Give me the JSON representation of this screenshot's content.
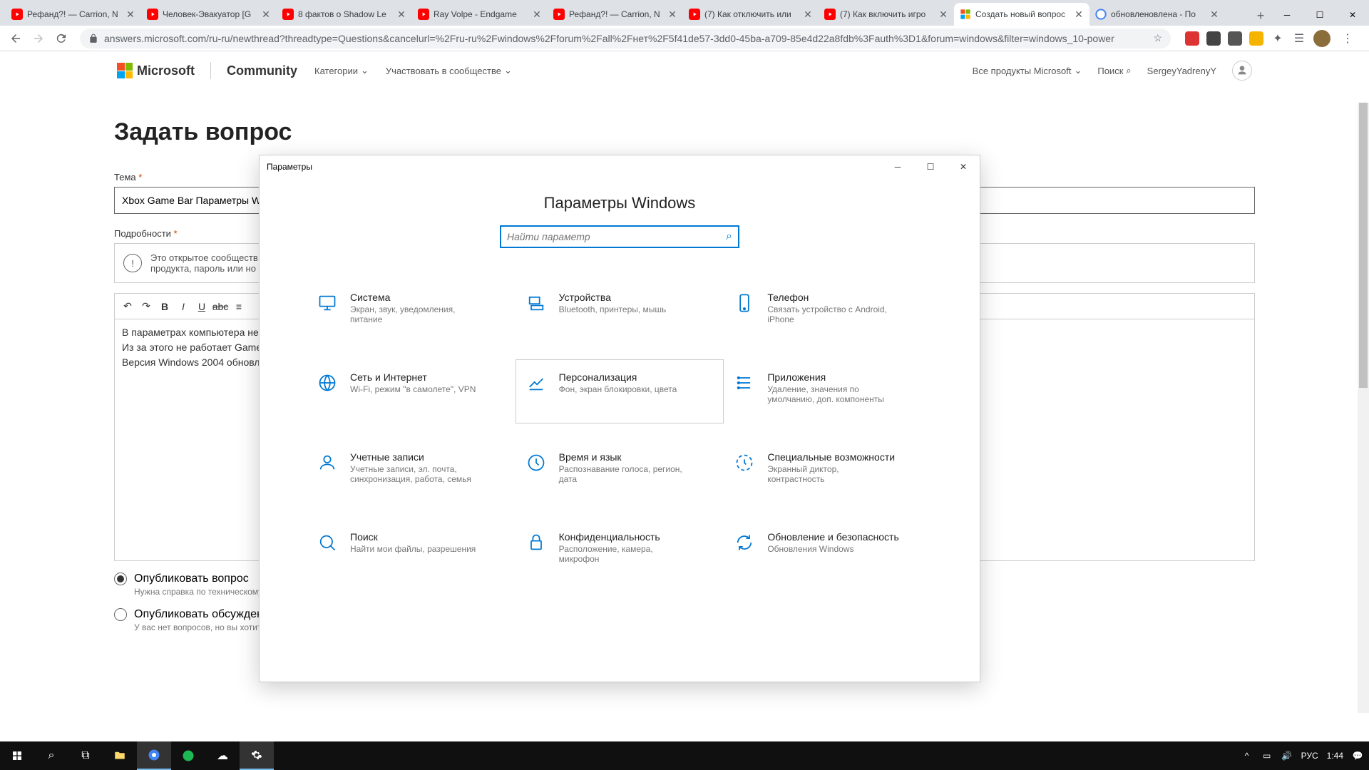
{
  "tabs": [
    {
      "title": "Рефанд?! — Carrion, N",
      "icon": "yt"
    },
    {
      "title": "Человек-Эвакуатор [G",
      "icon": "yt"
    },
    {
      "title": "8 фактов о Shadow Le",
      "icon": "yt"
    },
    {
      "title": "Ray Volpe - Endgame",
      "icon": "yt"
    },
    {
      "title": "Рефанд?! — Carrion, N",
      "icon": "yt"
    },
    {
      "title": "(7) Как отключить или",
      "icon": "yt"
    },
    {
      "title": "(7) Как включить игро",
      "icon": "yt"
    },
    {
      "title": "Создать новый вопрос",
      "icon": "ms",
      "active": true
    },
    {
      "title": "обновленовлена - По",
      "icon": "g"
    }
  ],
  "browser": {
    "url": "answers.microsoft.com/ru-ru/newthread?threadtype=Questions&cancelurl=%2Fru-ru%2Fwindows%2Fforum%2Fall%2Fнет%2F5f41de57-3dd0-45ba-a709-85e4d22a8fdb%3Fauth%3D1&forum=windows&filter=windows_10-power"
  },
  "ms": {
    "brand": "Microsoft",
    "community": "Community",
    "nav1": "Категории",
    "nav2": "Участвовать в сообществе",
    "right1": "Все продукты Microsoft",
    "search": "Поиск",
    "user": "SergeyYadrenyY",
    "h1": "Задать вопрос",
    "theme_label": "Тема",
    "theme_value": "Xbox Game Bar Параметры W",
    "details_label": "Подробности",
    "info_text": "Это открытое сообществ\nпродукта, пароль или но",
    "editor_line1": "В параметрах компьютера не",
    "editor_line2": "Из за этого не работает Game",
    "editor_line3": "Версия Windows 2004 обновл",
    "radio1": "Опубликовать вопрос",
    "radio1_desc": "Нужна справка по техническому вопросу? Требуется помощь? Выберите этот параметр, чтобы задать вопрос сообществу.",
    "radio2": "Опубликовать обсуждение",
    "radio2_desc": "У вас нет вопросов, но вы хотите поделиться своим мнением? У вас есть полезные советы? Выберите этот параметр, чтобы начать обсуждение в сообществе."
  },
  "settings": {
    "window_title": "Параметры",
    "title": "Параметры Windows",
    "search_placeholder": "Найти параметр",
    "items": [
      {
        "t": "Система",
        "d": "Экран, звук, уведомления, питание"
      },
      {
        "t": "Устройства",
        "d": "Bluetooth, принтеры, мышь"
      },
      {
        "t": "Телефон",
        "d": "Связать устройство с Android, iPhone"
      },
      {
        "t": "Сеть и Интернет",
        "d": "Wi-Fi, режим \"в самолете\", VPN"
      },
      {
        "t": "Персонализация",
        "d": "Фон, экран блокировки, цвета"
      },
      {
        "t": "Приложения",
        "d": "Удаление, значения по умолчанию, доп. компоненты"
      },
      {
        "t": "Учетные записи",
        "d": "Учетные записи, эл. почта, синхронизация, работа, семья"
      },
      {
        "t": "Время и язык",
        "d": "Распознавание голоса, регион, дата"
      },
      {
        "t": "Специальные возможности",
        "d": "Экранный диктор, контрастность"
      },
      {
        "t": "Поиск",
        "d": "Найти мои файлы, разрешения"
      },
      {
        "t": "Конфиденциальность",
        "d": "Расположение, камера, микрофон"
      },
      {
        "t": "Обновление и безопасность",
        "d": "Обновления Windows"
      }
    ]
  },
  "taskbar": {
    "lang": "РУС",
    "time": "1:44"
  }
}
